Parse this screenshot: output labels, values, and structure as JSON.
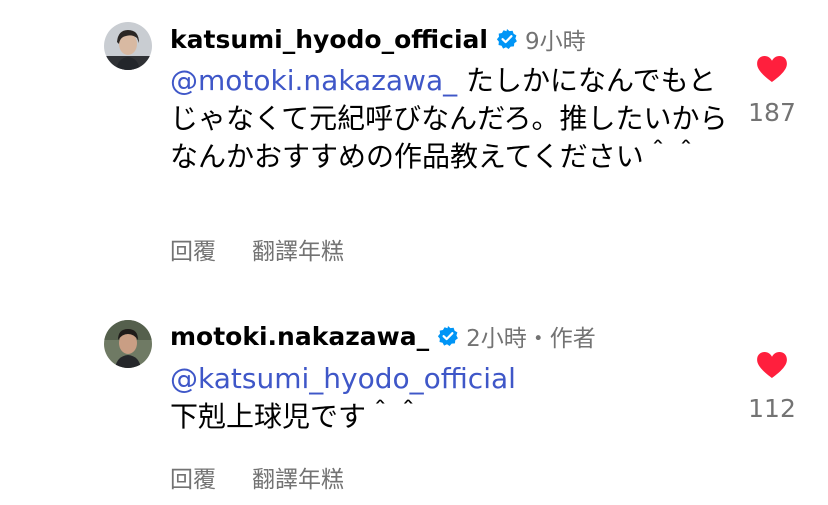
{
  "comments": [
    {
      "username": "katsumi_hyodo_official",
      "time": "9小時",
      "mention": "@motoki.nakazawa_",
      "text_after_mention": " たしかになんでもとじゃなくて元紀呼びなんだろ。推したいからなんかおすすめの作品教えてください＾＾",
      "text": "",
      "reply_label": "回覆",
      "translate_label": "翻譯年糕",
      "likes": "187",
      "liked": true,
      "verified": true,
      "avatar_icon": "avatar-photo-icon"
    },
    {
      "username": "motoki.nakazawa_",
      "time": "2小時・作者",
      "mention": "@katsumi_hyodo_official",
      "text": "下剋上球児です＾＾",
      "reply_label": "回覆",
      "translate_label": "翻譯年糕",
      "likes": "112",
      "liked": true,
      "verified": true,
      "avatar_icon": "avatar-photo-icon"
    }
  ],
  "colors": {
    "mention": "#3f57c8",
    "secondary_text": "#737373",
    "heart": "#ff1f3d",
    "verified": "#0095f6"
  }
}
